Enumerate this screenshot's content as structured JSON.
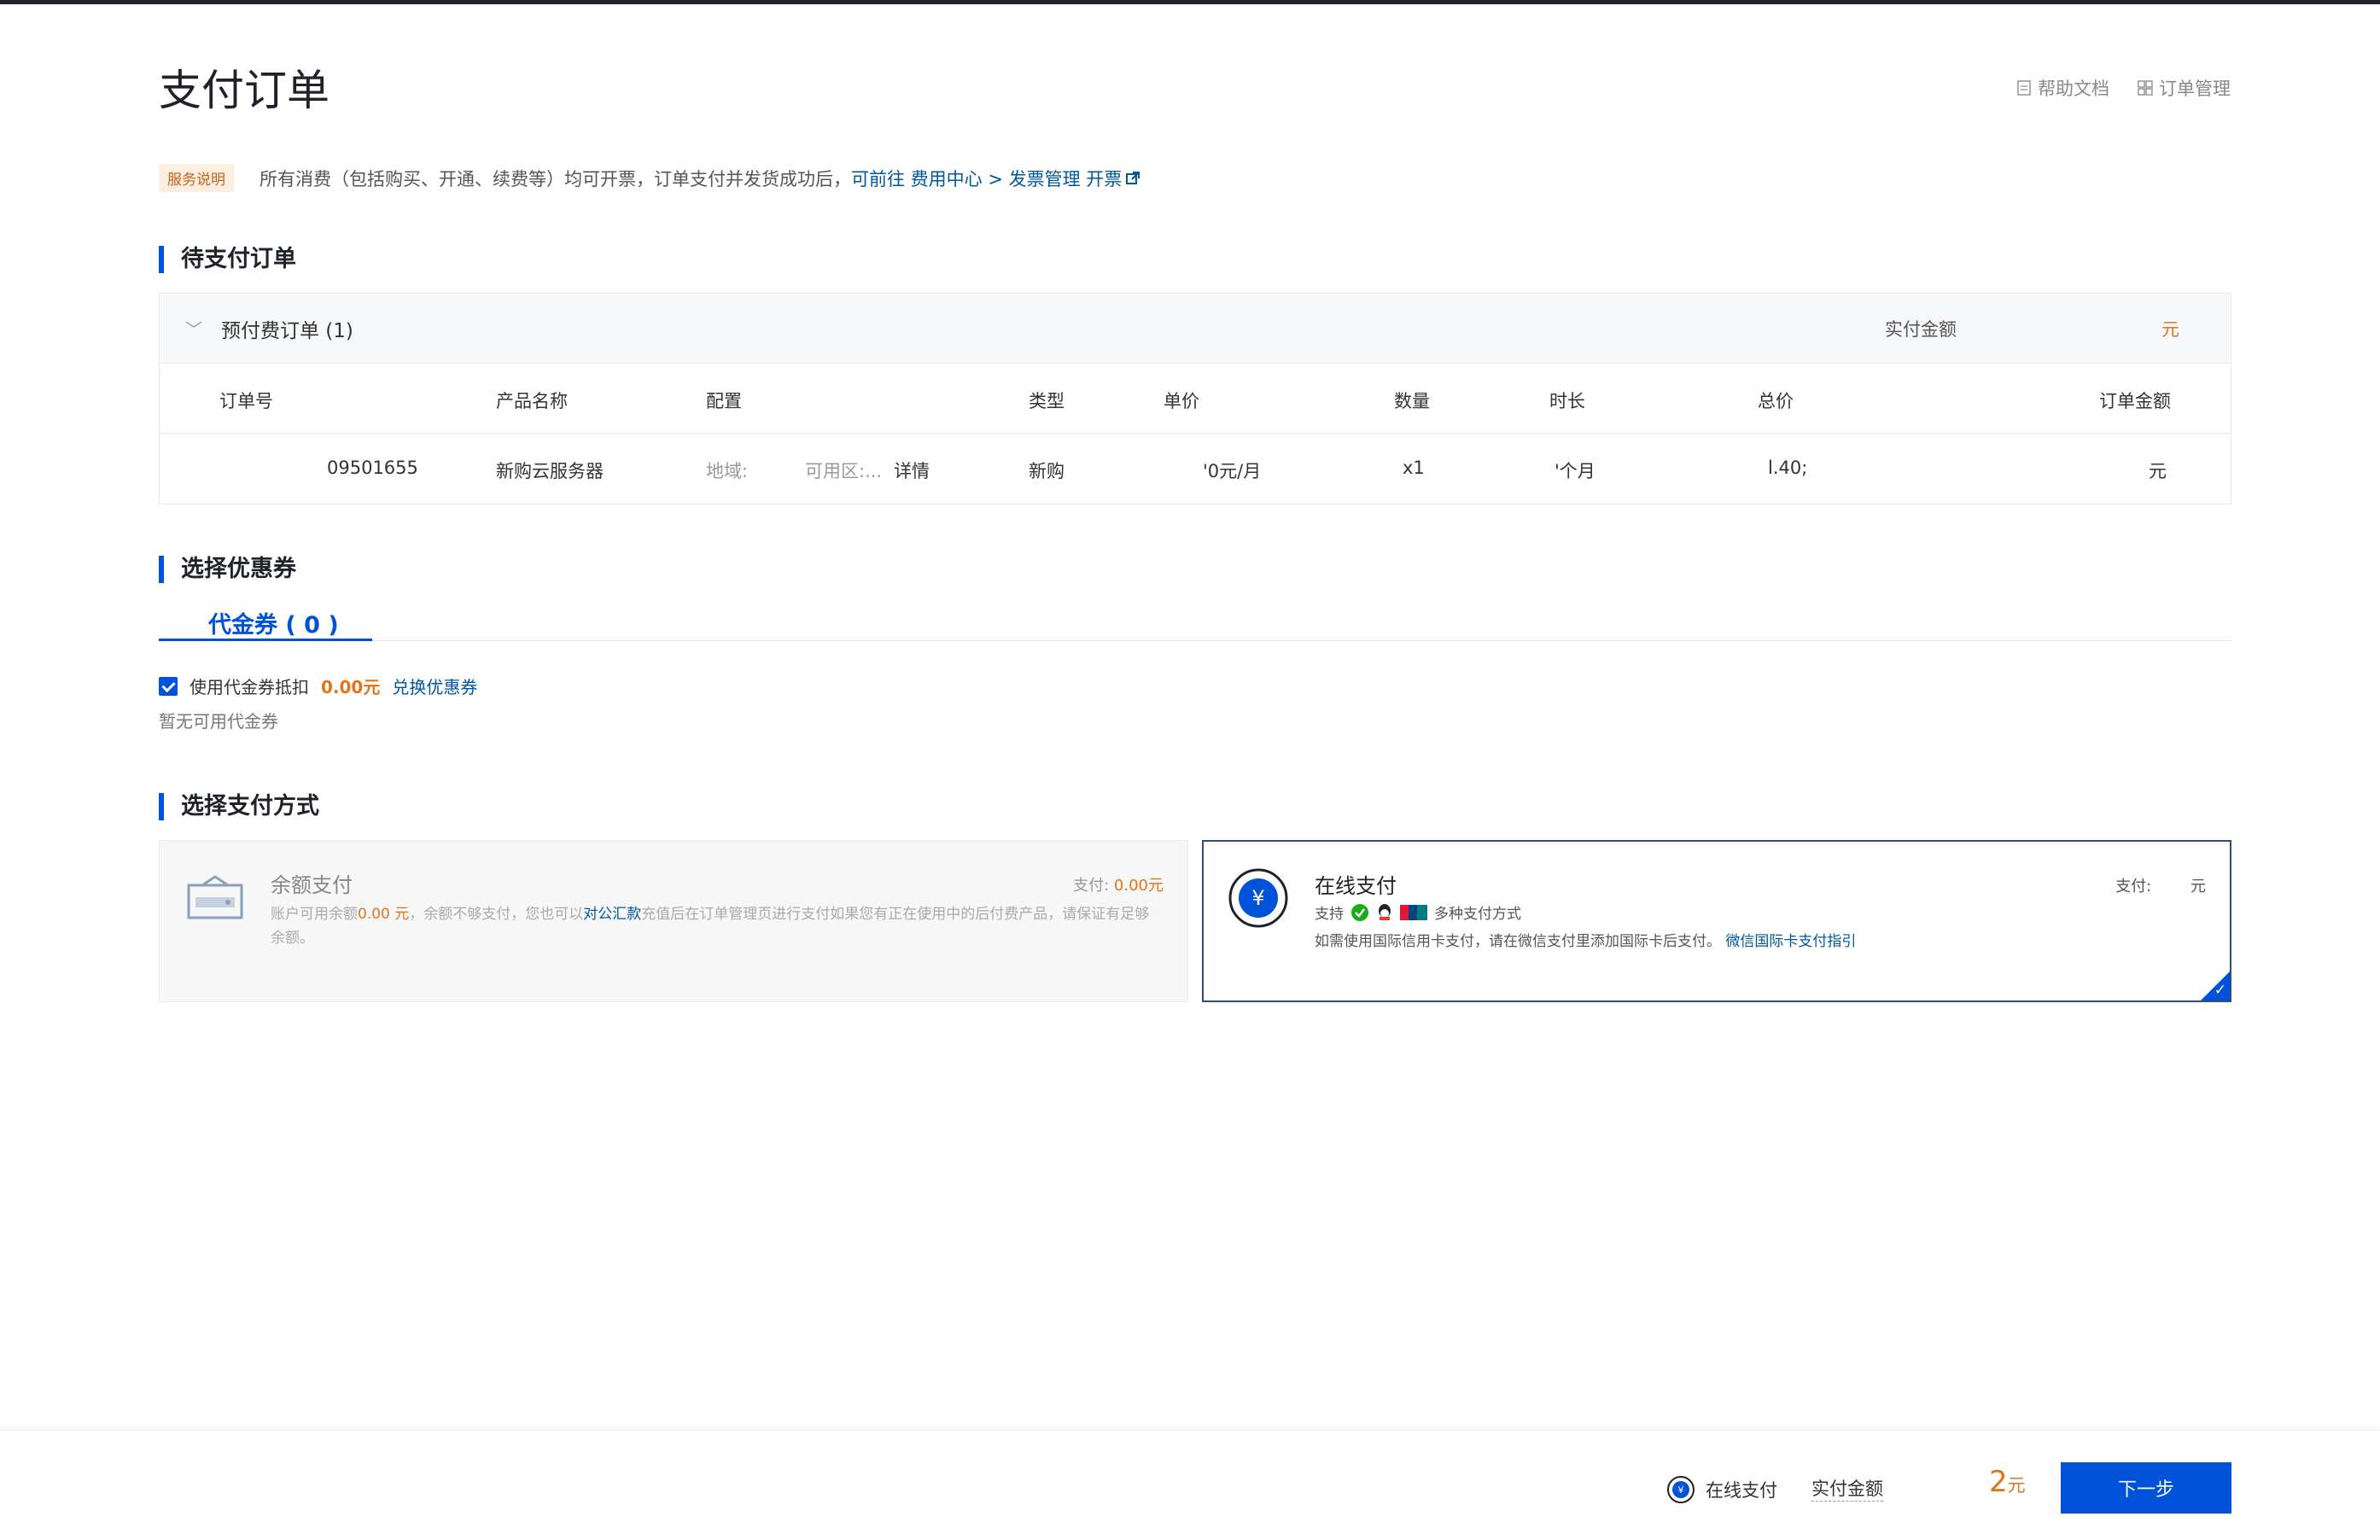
{
  "page": {
    "title": "支付订单",
    "help_doc": "帮助文档",
    "order_mgmt": "订单管理"
  },
  "notice": {
    "tag": "服务说明",
    "text": "所有消费（包括购买、开通、续费等）均可开票，订单支付并发货成功后，",
    "link_prefix": "可前往 费用中心 > 发票管理 开票"
  },
  "pending": {
    "section_title": "待支付订单",
    "group_label": "预付费订单 (1)",
    "paid_label": "实付金额",
    "paid_value_visible": "元",
    "columns": [
      "订单号",
      "产品名称",
      "配置",
      "类型",
      "单价",
      "数量",
      "时长",
      "总价",
      "订单金额"
    ],
    "row": {
      "order_no": "09501655",
      "product": "新购云服务器",
      "config_region": "地域:",
      "config_zone": "可用区:...",
      "config_detail_link": "详情",
      "type": "新购",
      "unit_price": "'0元/月",
      "qty": "x1",
      "duration": "'个月",
      "total": "l.40;",
      "order_amount": "元"
    }
  },
  "coupon": {
    "section_title": "选择优惠券",
    "tab_label": "代金券 ( 0 )",
    "use_label": "使用代金券抵扣",
    "use_amount": "0.00元",
    "redeem_link": "兑换优惠券",
    "empty_text": "暂无可用代金券"
  },
  "payment": {
    "section_title": "选择支付方式",
    "balance": {
      "name": "余额支付",
      "pay_label": "支付:",
      "pay_amount": "0.00元",
      "desc_1": "账户可用余额",
      "desc_amount": "0.00 元",
      "desc_2": "，余额不够支付，您也可以",
      "desc_link": "对公汇款",
      "desc_3": "充值后在订单管理页进行支付如果您有正在使用中的后付费产品，请保证有足够余额。"
    },
    "online": {
      "name": "在线支付",
      "pay_label": "支付:",
      "pay_unit": "元",
      "support_prefix": "支持",
      "support_suffix": "多种支付方式",
      "intl_note": "如需使用国际信用卡支付，请在微信支付里添加国际卡后支付。",
      "intl_link": "微信国际卡支付指引"
    }
  },
  "footer": {
    "method": "在线支付",
    "paid_label": "实付金额",
    "amount": "2",
    "amount_unit": "元",
    "next_button": "下一步"
  },
  "colors": {
    "primary": "#0052d9",
    "accent_orange": "#e0751e",
    "link": "#00579e"
  }
}
